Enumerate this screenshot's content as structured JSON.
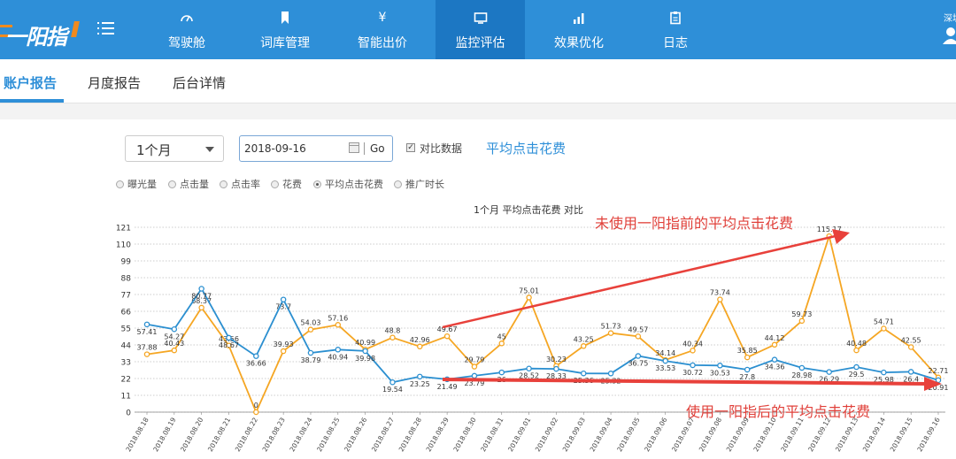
{
  "brand": {
    "logo_text": "一阳指"
  },
  "nav": {
    "items": [
      {
        "label": "驾驶舱",
        "icon": "gauge-icon"
      },
      {
        "label": "词库管理",
        "icon": "bookmark-icon"
      },
      {
        "label": "智能出价",
        "icon": "yen-icon"
      },
      {
        "label": "监控评估",
        "icon": "monitor-icon"
      },
      {
        "label": "效果优化",
        "icon": "bar-chart-icon"
      },
      {
        "label": "日志",
        "icon": "clipboard-icon"
      }
    ],
    "active_index": 3,
    "user_label": "深圳"
  },
  "subtabs": {
    "items": [
      "账户报告",
      "月度报告",
      "后台详情"
    ],
    "active_index": 0
  },
  "filters": {
    "period": "1个月",
    "date": "2018-09-16",
    "go_label": "Go",
    "compare_label": "对比数据",
    "compare_checked": true,
    "metric_title": "平均点击花费"
  },
  "metrics": {
    "items": [
      "曝光量",
      "点击量",
      "点击率",
      "花费",
      "平均点击花费",
      "推广时长"
    ],
    "selected_index": 4
  },
  "chart_data": {
    "type": "line",
    "title": "1个月  平均点击花费  对比",
    "xlabel": "",
    "ylabel": "",
    "ylim": [
      0,
      121
    ],
    "yticks": [
      0,
      11,
      22,
      33,
      44,
      55,
      66,
      77,
      88,
      99,
      110,
      121
    ],
    "categories": [
      "2018.08.18",
      "2018.08.19",
      "2018.08.20",
      "2018.08.21",
      "2018.08.22",
      "2018.08.23",
      "2018.08.24",
      "2018.08.25",
      "2018.08.26",
      "2018.08.27",
      "2018.08.28",
      "2018.08.29",
      "2018.08.30",
      "2018.08.31",
      "2018.09.01",
      "2018.09.02",
      "2018.09.03",
      "2018.09.04",
      "2018.09.05",
      "2018.09.06",
      "2018.09.07",
      "2018.09.08",
      "2018.09.09",
      "2018.09.10",
      "2018.09.11",
      "2018.09.12",
      "2018.09.13",
      "2018.09.14",
      "2018.09.15",
      "2018.09.16"
    ],
    "series": [
      {
        "color": "#f5a623",
        "values": [
          37.88,
          40.43,
          68.37,
          43.56,
          0,
          39.93,
          54.03,
          57.16,
          40.99,
          48.8,
          42.96,
          49.67,
          29.79,
          45,
          75.01,
          30.23,
          43.25,
          51.73,
          49.57,
          34.14,
          40.34,
          73.74,
          35.85,
          44.12,
          59.73,
          115.17,
          40.48,
          54.71,
          42.55,
          22.71
        ]
      },
      {
        "color": "#2b8fd0",
        "values": [
          57.41,
          54.27,
          80.77,
          48.67,
          36.66,
          73.7,
          38.79,
          40.94,
          39.98,
          19.54,
          23.25,
          21.49,
          23.79,
          26,
          28.52,
          28.33,
          25.36,
          25.32,
          36.75,
          33.53,
          30.72,
          30.53,
          27.8,
          34.36,
          28.98,
          26.29,
          29.5,
          25.98,
          26.4,
          20.91
        ]
      }
    ],
    "grid": true
  },
  "annotations": {
    "top": "未使用一阳指前的平均点击花费",
    "bottom": "使用一阳指后的平均点击花费",
    "arrow_color": "#e8413b"
  }
}
